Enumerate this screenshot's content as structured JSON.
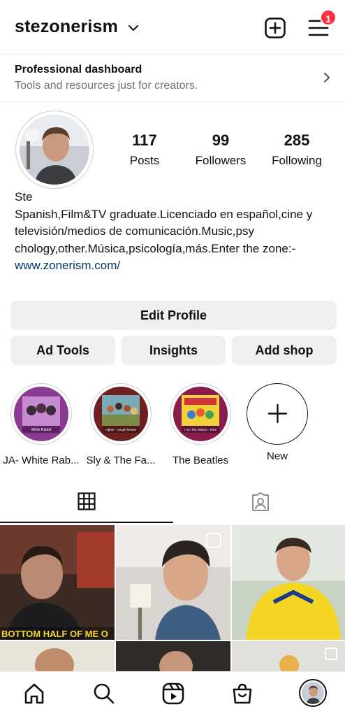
{
  "header": {
    "username": "stezonerism",
    "notification_count": "1"
  },
  "dashboard": {
    "title": "Professional dashboard",
    "subtitle": "Tools and resources just for creators."
  },
  "profile": {
    "stats": [
      {
        "value": "117",
        "label": "Posts"
      },
      {
        "value": "99",
        "label": "Followers"
      },
      {
        "value": "285",
        "label": "Following"
      }
    ],
    "name": "Ste",
    "bio": "Spanish,Film&TV graduate.Licenciado en español,cine y televisión/medios de comunicación.Music,psy chology,other.Música,psicología,más.Enter the zone:-",
    "link": "www.zonerism.com/"
  },
  "buttons": {
    "edit_profile": "Edit Profile",
    "ad_tools": "Ad Tools",
    "insights": "Insights",
    "add_shop": "Add shop"
  },
  "highlights": [
    {
      "label": "JA- White Rab...",
      "cover_text": "White Rabbit"
    },
    {
      "label": "Sly & The Fa...",
      "cover_text": "Higher - Single Master"
    },
    {
      "label": "The Beatles",
      "cover_text": "I Am The Walrus - Rem"
    },
    {
      "label": "New"
    }
  ],
  "posts": [
    {
      "caption": "BOTTOM HALF OF ME O"
    }
  ],
  "icons": {
    "header": [
      "chevron-down-icon",
      "add-post-icon",
      "menu-icon"
    ],
    "tabs": [
      "grid-icon",
      "tagged-icon"
    ],
    "nav": [
      "home-icon",
      "search-icon",
      "reels-icon",
      "shop-icon",
      "profile-avatar"
    ]
  },
  "colors": {
    "notification": "#ff3040",
    "link": "#00376b",
    "button_bg": "#efefef"
  }
}
